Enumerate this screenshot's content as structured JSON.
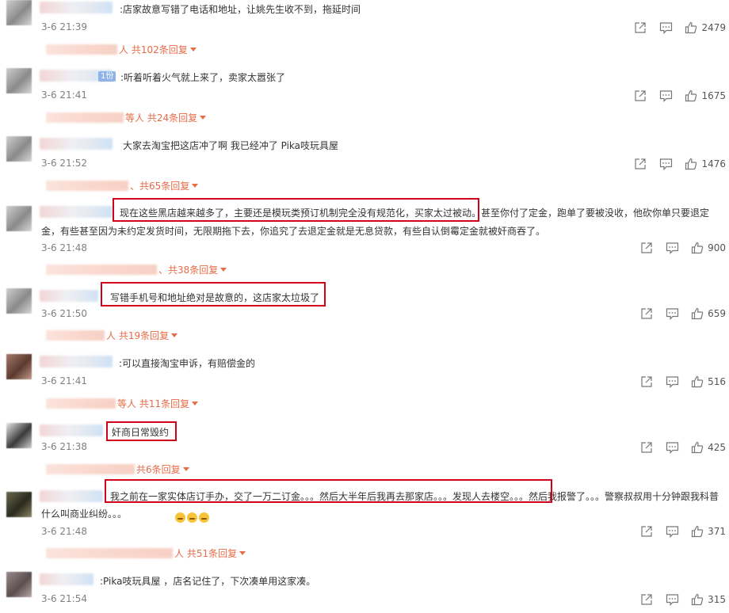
{
  "comments": [
    {
      "badge": "",
      "text": ":店家故意写错了电话和地址，让姚先生收不到，拖延时间",
      "time": "3-6 21:39",
      "likes": "2479",
      "replies": "人 共102条回复"
    },
    {
      "badge": "1份",
      "text": ":听着听着火气就上来了，卖家太嚣张了",
      "time": "3-6 21:41",
      "likes": "1675",
      "replies": "等人 共24条回复"
    },
    {
      "badge": "",
      "text": "大家去淘宝把这店冲了啊 我已经冲了 Pika吱玩具屋",
      "time": "3-6 21:52",
      "likes": "1476",
      "replies": "、共65条回复"
    },
    {
      "badge": "",
      "text": "现在这些黑店越来越多了，主要还是模玩类预订机制完全没有规范化，买家太过被动。甚至你付了定金，跑单了要被没收，他砍你单只要退定金，有些甚至因为未约定发货时间，无限期拖下去，你追究了去退定金就是无息贷款，有些自认倒霉定金就被奸商吞了。",
      "time": "3-6 21:48",
      "likes": "900",
      "replies": "、共38条回复"
    },
    {
      "badge": "",
      "text": "写错手机号和地址绝对是故意的，这店家太垃圾了",
      "time": "3-6 21:50",
      "likes": "659",
      "replies": "人 共19条回复"
    },
    {
      "badge": "",
      "text": ":可以直接淘宝申诉，有赔偿金的",
      "time": "3-6 21:41",
      "likes": "516",
      "replies": "等人 共11条回复"
    },
    {
      "badge": "",
      "text": "奸商日常毁约",
      "time": "3-6 21:38",
      "likes": "425",
      "replies": "共6条回复"
    },
    {
      "badge": "",
      "text": "我之前在一家实体店订手办，交了一万二订金。。。然后大半年后我再去那家店。。。发现人去楼空。。。然后我报警了。。。警察叔叔用十分钟跟我科普什么叫商业纠纷。。。",
      "time": "3-6 21:48",
      "likes": "371",
      "replies": "人 共51条回复"
    },
    {
      "badge": "",
      "text": ":Pika吱玩具屋 ，店名记住了，下次凑单用这家凑。",
      "time": "3-6 21:54",
      "likes": "315",
      "replies": ""
    }
  ],
  "icons": {
    "share": "share-icon",
    "comment": "comment-icon",
    "like": "thumbs-up-icon",
    "emoji": "smiley-emoji-icon"
  },
  "colors": {
    "reply_link": "#e86b47",
    "highlight": "#d0021b",
    "time": "#808080"
  }
}
